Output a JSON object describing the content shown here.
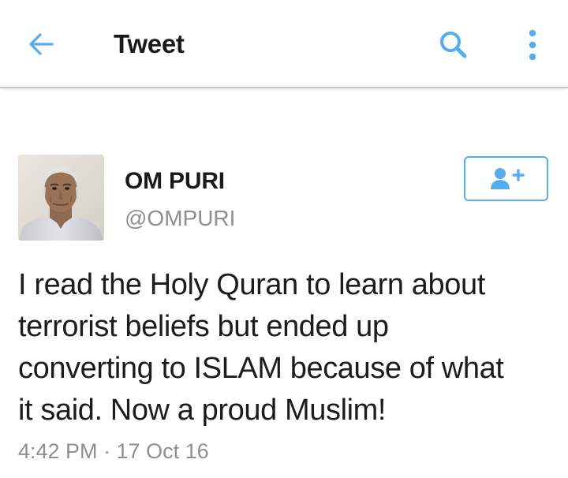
{
  "header": {
    "title": "Tweet",
    "back_icon": "arrow-left-icon",
    "search_icon": "search-icon",
    "more_icon": "more-vertical-icon"
  },
  "tweet": {
    "author_name": "OM PURI",
    "author_handle": "@OMPURI",
    "text_lines": [
      "I read the Holy Quran to learn about",
      "terrorist beliefs but ended up",
      "converting to ISLAM because of what",
      "it said. Now a proud Muslim!"
    ],
    "timestamp": "4:42 PM · 17 Oct 16",
    "follow_icon": "follow-user-icon"
  },
  "colors": {
    "accent": "#55acee",
    "handle_gray": "#8f8f8f",
    "text": "#1c1c1c"
  }
}
